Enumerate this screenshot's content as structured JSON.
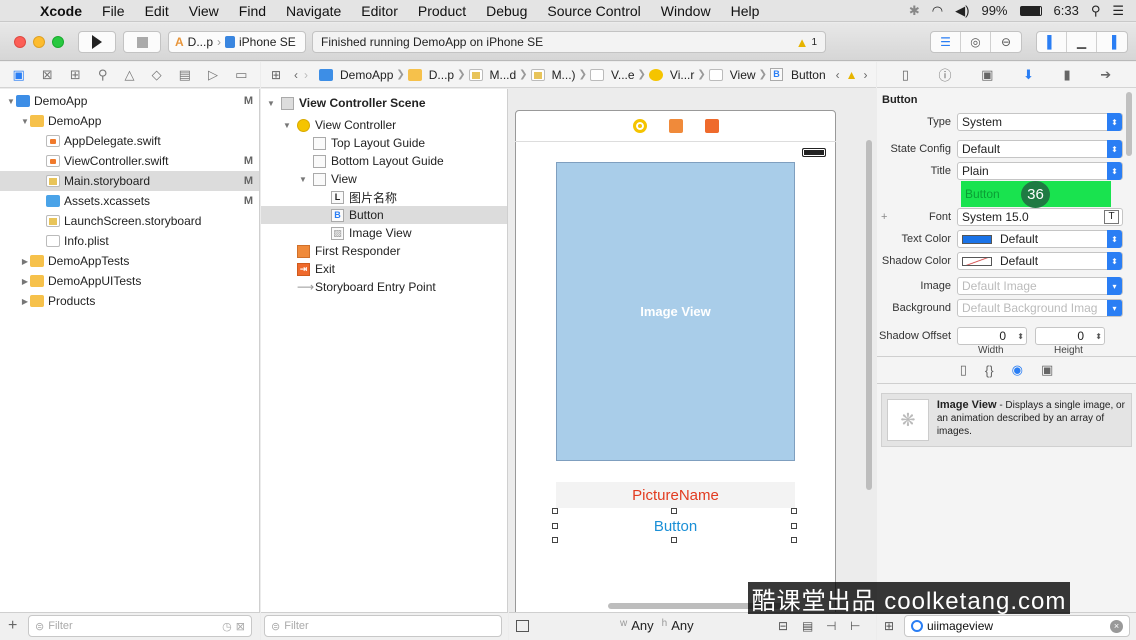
{
  "menubar": {
    "app": "Xcode",
    "items": [
      "File",
      "Edit",
      "View",
      "Find",
      "Navigate",
      "Editor",
      "Product",
      "Debug",
      "Source Control",
      "Window",
      "Help"
    ],
    "battery": "99%",
    "time": "6:33"
  },
  "toolbar": {
    "scheme_target": "D...p",
    "scheme_device": "iPhone SE",
    "activity": "Finished running DemoApp on iPhone SE",
    "warning_count": "1"
  },
  "navigator": {
    "items": [
      {
        "label": "DemoApp",
        "status": "M"
      },
      {
        "label": "DemoApp",
        "status": ""
      },
      {
        "label": "AppDelegate.swift",
        "status": ""
      },
      {
        "label": "ViewController.swift",
        "status": "M"
      },
      {
        "label": "Main.storyboard",
        "status": "M"
      },
      {
        "label": "Assets.xcassets",
        "status": "M"
      },
      {
        "label": "LaunchScreen.storyboard",
        "status": ""
      },
      {
        "label": "Info.plist",
        "status": ""
      },
      {
        "label": "DemoAppTests",
        "status": ""
      },
      {
        "label": "DemoAppUITests",
        "status": ""
      },
      {
        "label": "Products",
        "status": ""
      }
    ],
    "filter_placeholder": "Filter"
  },
  "jumpbar": [
    "DemoApp",
    "D...p",
    "M...d",
    "M...)",
    "V...e",
    "Vi...r",
    "View",
    "Button"
  ],
  "outline": {
    "items": [
      "View Controller Scene",
      "View Controller",
      "Top Layout Guide",
      "Bottom Layout Guide",
      "View",
      "图片名称",
      "Button",
      "Image View",
      "First Responder",
      "Exit",
      "Storyboard Entry Point"
    ],
    "filter_placeholder": "Filter"
  },
  "canvas": {
    "image_view": "Image View",
    "picture_label": "PictureName",
    "button": "Button",
    "size_w": "Any",
    "size_h": "Any"
  },
  "inspector": {
    "header": "Button",
    "type_label": "Type",
    "type_value": "System",
    "state_label": "State Config",
    "state_value": "Default",
    "title_label": "Title",
    "title_value": "Plain",
    "title_text": "Button",
    "badge": "36",
    "font_label": "Font",
    "font_value": "System 15.0",
    "textcolor_label": "Text Color",
    "textcolor_value": "Default",
    "shadowcolor_label": "Shadow Color",
    "shadowcolor_value": "Default",
    "image_label": "Image",
    "image_placeholder": "Default Image",
    "bg_label": "Background",
    "bg_placeholder": "Default Background Imag",
    "shadow_offset_label": "Shadow Offset",
    "offset_w": "0",
    "offset_h": "0",
    "width_label": "Width",
    "height_label": "Height"
  },
  "library": {
    "title": "Image View",
    "desc": " - Displays a single image, or an animation described by an array of images.",
    "search": "uiimageview"
  },
  "watermark": "酷课堂出品 coolketang.com",
  "colors": {
    "accent": "#2a7ef4",
    "highlight": "#19e34f",
    "badge": "#1f7a43"
  }
}
